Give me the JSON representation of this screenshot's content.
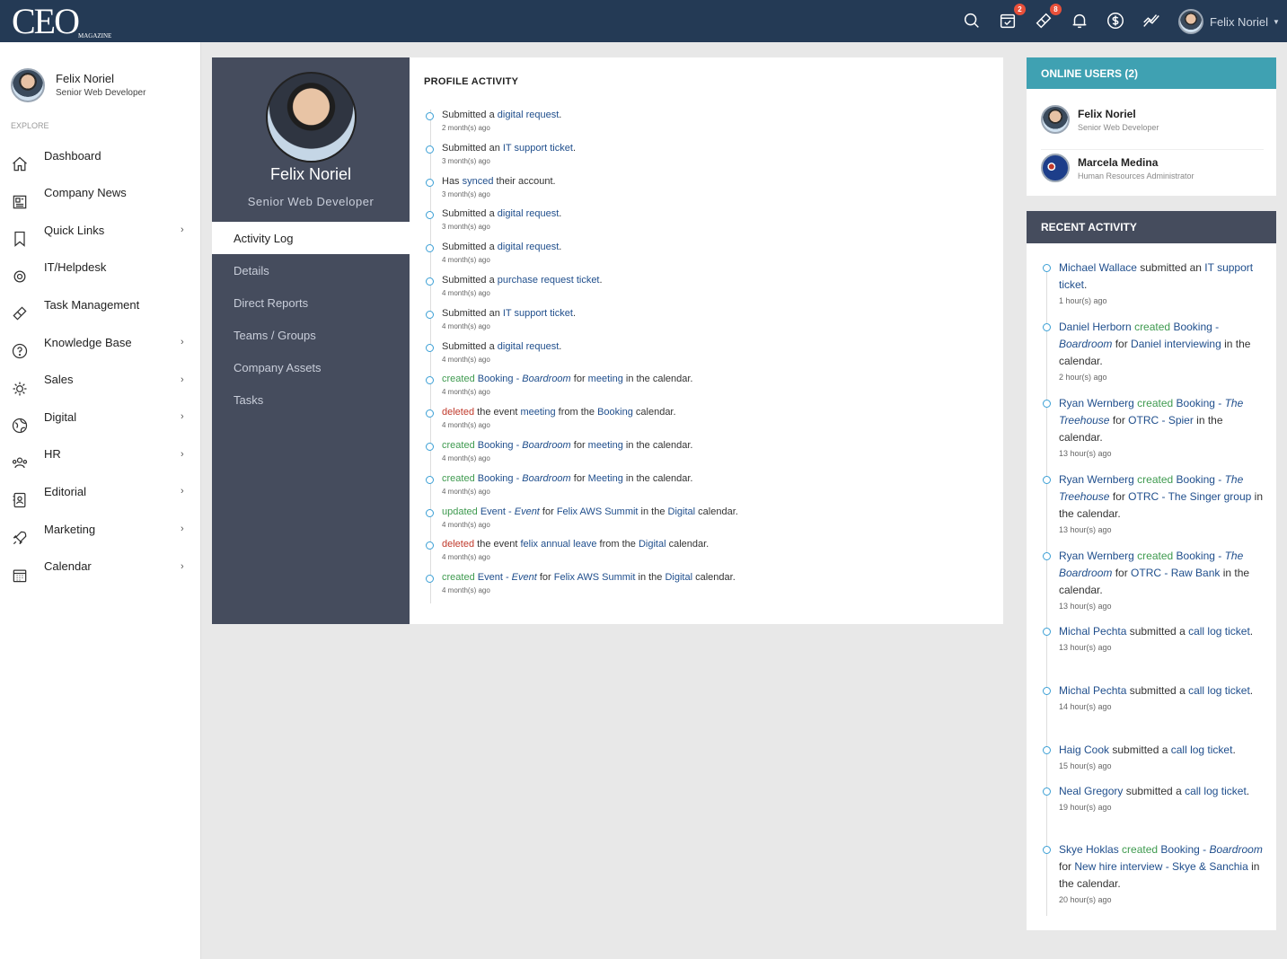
{
  "brand": {
    "logo": "CEO",
    "logo_sub": "MAGAZINE"
  },
  "topbar": {
    "user_name": "Felix Noriel",
    "calendar_badge": "2",
    "tickets_badge": "8",
    "icons": [
      "search-icon",
      "calendar-check-icon",
      "ticket-icon",
      "bell-icon",
      "dollar-icon",
      "trend-icon"
    ]
  },
  "sidebar": {
    "user_name": "Felix Noriel",
    "user_role": "Senior Web Developer",
    "section": "EXPLORE",
    "items": [
      {
        "label": "Dashboard",
        "icon": "home-icon",
        "submenu": false
      },
      {
        "label": "Company News",
        "icon": "newspaper-icon",
        "submenu": false
      },
      {
        "label": "Quick Links",
        "icon": "bookmark-icon",
        "submenu": true
      },
      {
        "label": "IT/Helpdesk",
        "icon": "lifebuoy-icon",
        "submenu": false
      },
      {
        "label": "Task Management",
        "icon": "ticket-icon",
        "submenu": false
      },
      {
        "label": "Knowledge Base",
        "icon": "question-icon",
        "submenu": true
      },
      {
        "label": "Sales",
        "icon": "gear-icon",
        "submenu": true
      },
      {
        "label": "Digital",
        "icon": "globe-icon",
        "submenu": true
      },
      {
        "label": "HR",
        "icon": "people-icon",
        "submenu": true
      },
      {
        "label": "Editorial",
        "icon": "contact-book-icon",
        "submenu": true
      },
      {
        "label": "Marketing",
        "icon": "rocket-icon",
        "submenu": true
      },
      {
        "label": "Calendar",
        "icon": "calendar-icon",
        "submenu": true
      }
    ],
    "chevron": "›"
  },
  "profile": {
    "name": "Felix Noriel",
    "role": "Senior Web Developer",
    "tabs": [
      "Activity Log",
      "Details",
      "Direct Reports",
      "Teams / Groups",
      "Company Assets",
      "Tasks"
    ],
    "activity_title": "PROFILE ACTIVITY",
    "activities": [
      {
        "segs": [
          [
            "t",
            "Submitted a "
          ],
          [
            "l",
            "digital request"
          ],
          [
            "t",
            "."
          ]
        ],
        "time": "2 month(s) ago"
      },
      {
        "segs": [
          [
            "t",
            "Submitted an "
          ],
          [
            "l",
            "IT support ticket"
          ],
          [
            "t",
            "."
          ]
        ],
        "time": "3 month(s) ago"
      },
      {
        "segs": [
          [
            "t",
            "Has "
          ],
          [
            "l",
            "synced"
          ],
          [
            "t",
            " their account."
          ]
        ],
        "time": "3 month(s) ago"
      },
      {
        "segs": [
          [
            "t",
            "Submitted a "
          ],
          [
            "l",
            "digital request"
          ],
          [
            "t",
            "."
          ]
        ],
        "time": "3 month(s) ago"
      },
      {
        "segs": [
          [
            "t",
            "Submitted a "
          ],
          [
            "l",
            "digital request"
          ],
          [
            "t",
            "."
          ]
        ],
        "time": "4 month(s) ago"
      },
      {
        "segs": [
          [
            "t",
            "Submitted a "
          ],
          [
            "l",
            "purchase request ticket"
          ],
          [
            "t",
            "."
          ]
        ],
        "time": "4 month(s) ago"
      },
      {
        "segs": [
          [
            "t",
            "Submitted an "
          ],
          [
            "l",
            "IT support ticket"
          ],
          [
            "t",
            "."
          ]
        ],
        "time": "4 month(s) ago"
      },
      {
        "segs": [
          [
            "t",
            "Submitted a "
          ],
          [
            "l",
            "digital request"
          ],
          [
            "t",
            "."
          ]
        ],
        "time": "4 month(s) ago"
      },
      {
        "segs": [
          [
            "g",
            "created"
          ],
          [
            "t",
            " "
          ],
          [
            "l",
            "Booking - "
          ],
          [
            "li",
            "Boardroom"
          ],
          [
            "t",
            " for "
          ],
          [
            "l",
            "meeting"
          ],
          [
            "t",
            " in the calendar."
          ]
        ],
        "time": "4 month(s) ago"
      },
      {
        "segs": [
          [
            "r",
            "deleted"
          ],
          [
            "t",
            " the event "
          ],
          [
            "l",
            "meeting"
          ],
          [
            "t",
            " from the "
          ],
          [
            "l",
            "Booking"
          ],
          [
            "t",
            " calendar."
          ]
        ],
        "time": "4 month(s) ago"
      },
      {
        "segs": [
          [
            "g",
            "created"
          ],
          [
            "t",
            " "
          ],
          [
            "l",
            "Booking - "
          ],
          [
            "li",
            "Boardroom"
          ],
          [
            "t",
            " for "
          ],
          [
            "l",
            "meeting"
          ],
          [
            "t",
            " in the calendar."
          ]
        ],
        "time": "4 month(s) ago"
      },
      {
        "segs": [
          [
            "g",
            "created"
          ],
          [
            "t",
            " "
          ],
          [
            "l",
            "Booking - "
          ],
          [
            "li",
            "Boardroom"
          ],
          [
            "t",
            " for "
          ],
          [
            "l",
            "Meeting"
          ],
          [
            "t",
            " in the calendar."
          ]
        ],
        "time": "4 month(s) ago"
      },
      {
        "segs": [
          [
            "g",
            "updated"
          ],
          [
            "t",
            " "
          ],
          [
            "l",
            "Event - "
          ],
          [
            "li",
            "Event"
          ],
          [
            "t",
            " for "
          ],
          [
            "l",
            "Felix AWS Summit"
          ],
          [
            "t",
            " in the "
          ],
          [
            "l",
            "Digital"
          ],
          [
            "t",
            " calendar."
          ]
        ],
        "time": "4 month(s) ago"
      },
      {
        "segs": [
          [
            "r",
            "deleted"
          ],
          [
            "t",
            " the event "
          ],
          [
            "l",
            "felix annual leave"
          ],
          [
            "t",
            " from the "
          ],
          [
            "l",
            "Digital"
          ],
          [
            "t",
            " calendar."
          ]
        ],
        "time": "4 month(s) ago"
      },
      {
        "segs": [
          [
            "g",
            "created"
          ],
          [
            "t",
            " "
          ],
          [
            "l",
            "Event - "
          ],
          [
            "li",
            "Event"
          ],
          [
            "t",
            " for "
          ],
          [
            "l",
            "Felix AWS Summit"
          ],
          [
            "t",
            " in the "
          ],
          [
            "l",
            "Digital"
          ],
          [
            "t",
            " calendar."
          ]
        ],
        "time": "4 month(s) ago"
      }
    ]
  },
  "online": {
    "title": "ONLINE USERS (2)",
    "users": [
      {
        "name": "Felix Noriel",
        "role": "Senior Web Developer",
        "avatar": "photo"
      },
      {
        "name": "Marcela Medina",
        "role": "Human Resources Administrator",
        "avatar": "flag"
      }
    ]
  },
  "recent": {
    "title": "RECENT ACTIVITY",
    "items": [
      {
        "segs": [
          [
            "l",
            "Michael Wallace"
          ],
          [
            "t",
            " submitted an "
          ],
          [
            "l",
            "IT support ticket"
          ],
          [
            "t",
            "."
          ]
        ],
        "time": "1 hour(s) ago"
      },
      {
        "segs": [
          [
            "l",
            "Daniel Herborn"
          ],
          [
            "t",
            " "
          ],
          [
            "g",
            "created"
          ],
          [
            "t",
            " "
          ],
          [
            "l",
            "Booking - "
          ],
          [
            "li",
            "Boardroom"
          ],
          [
            "t",
            " for "
          ],
          [
            "l",
            "Daniel interviewing"
          ],
          [
            "t",
            " in the calendar."
          ]
        ],
        "time": "2 hour(s) ago"
      },
      {
        "segs": [
          [
            "l",
            "Ryan Wernberg"
          ],
          [
            "t",
            " "
          ],
          [
            "g",
            "created"
          ],
          [
            "t",
            " "
          ],
          [
            "l",
            "Booking - "
          ],
          [
            "li",
            "The Treehouse"
          ],
          [
            "t",
            " for "
          ],
          [
            "l",
            "OTRC - Spier"
          ],
          [
            "t",
            " in the calendar."
          ]
        ],
        "time": "13 hour(s) ago"
      },
      {
        "segs": [
          [
            "l",
            "Ryan Wernberg"
          ],
          [
            "t",
            " "
          ],
          [
            "g",
            "created"
          ],
          [
            "t",
            " "
          ],
          [
            "l",
            "Booking - "
          ],
          [
            "li",
            "The Treehouse"
          ],
          [
            "t",
            " for "
          ],
          [
            "l",
            "OTRC - The Singer group"
          ],
          [
            "t",
            " in the calendar."
          ]
        ],
        "time": "13 hour(s) ago"
      },
      {
        "segs": [
          [
            "l",
            "Ryan Wernberg"
          ],
          [
            "t",
            " "
          ],
          [
            "g",
            "created"
          ],
          [
            "t",
            " "
          ],
          [
            "l",
            "Booking - "
          ],
          [
            "li",
            "The Boardroom"
          ],
          [
            "t",
            " for "
          ],
          [
            "l",
            "OTRC - Raw Bank"
          ],
          [
            "t",
            " in the calendar."
          ]
        ],
        "time": "13 hour(s) ago"
      },
      {
        "segs": [
          [
            "l",
            "Michal Pechta"
          ],
          [
            "t",
            " submitted a "
          ],
          [
            "l",
            "call log ticket"
          ],
          [
            "t",
            "."
          ]
        ],
        "time": "13 hour(s) ago"
      },
      {
        "segs": [
          [
            "l",
            "Michal Pechta"
          ],
          [
            "t",
            " submitted a "
          ],
          [
            "l",
            "call log ticket"
          ],
          [
            "t",
            "."
          ]
        ],
        "time": "14 hour(s) ago"
      },
      {
        "segs": [
          [
            "l",
            "Haig Cook"
          ],
          [
            "t",
            " submitted a "
          ],
          [
            "l",
            "call log ticket"
          ],
          [
            "t",
            "."
          ]
        ],
        "time": "15 hour(s) ago"
      },
      {
        "segs": [
          [
            "l",
            "Neal Gregory"
          ],
          [
            "t",
            " submitted a "
          ],
          [
            "l",
            "call log ticket"
          ],
          [
            "t",
            "."
          ]
        ],
        "time": "19 hour(s) ago"
      },
      {
        "segs": [
          [
            "l",
            "Skye Hoklas"
          ],
          [
            "t",
            " "
          ],
          [
            "g",
            "created"
          ],
          [
            "t",
            " "
          ],
          [
            "l",
            "Booking - "
          ],
          [
            "li",
            "Boardroom"
          ],
          [
            "t",
            " for "
          ],
          [
            "l",
            "New hire interview - Skye & Sanchia"
          ],
          [
            "t",
            " in the calendar."
          ]
        ],
        "time": "20 hour(s) ago"
      }
    ]
  }
}
